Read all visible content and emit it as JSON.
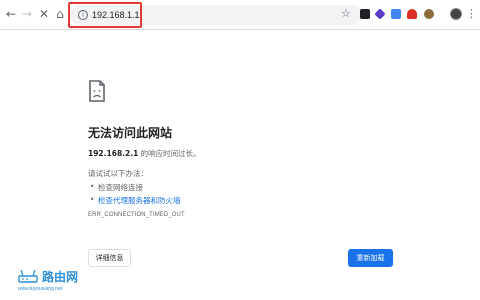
{
  "toolbar": {
    "back_icon": "←",
    "forward_icon": "→",
    "stop_icon": "✕",
    "home_icon": "⌂",
    "url": "192.168.1.1",
    "info_icon": "i",
    "star_icon": "☆",
    "menu_icon": "⋮"
  },
  "error": {
    "title": "无法访问此网站",
    "host": "192.168.2.1",
    "message_suffix": " 的响应时间过长。",
    "try_heading": "请试试以下办法：",
    "suggestions": [
      "检查网络连接",
      "检查代理服务器和防火墙"
    ],
    "code": "ERR_CONNECTION_TIMED_OUT",
    "details_label": "详细信息",
    "reload_label": "重新加载"
  },
  "watermark": {
    "name": "路由网",
    "url": "www.luyouwang.net"
  },
  "colors": {
    "accent": "#1a73e8",
    "highlight": "#e53935",
    "watermark": "#2d8fd5"
  }
}
